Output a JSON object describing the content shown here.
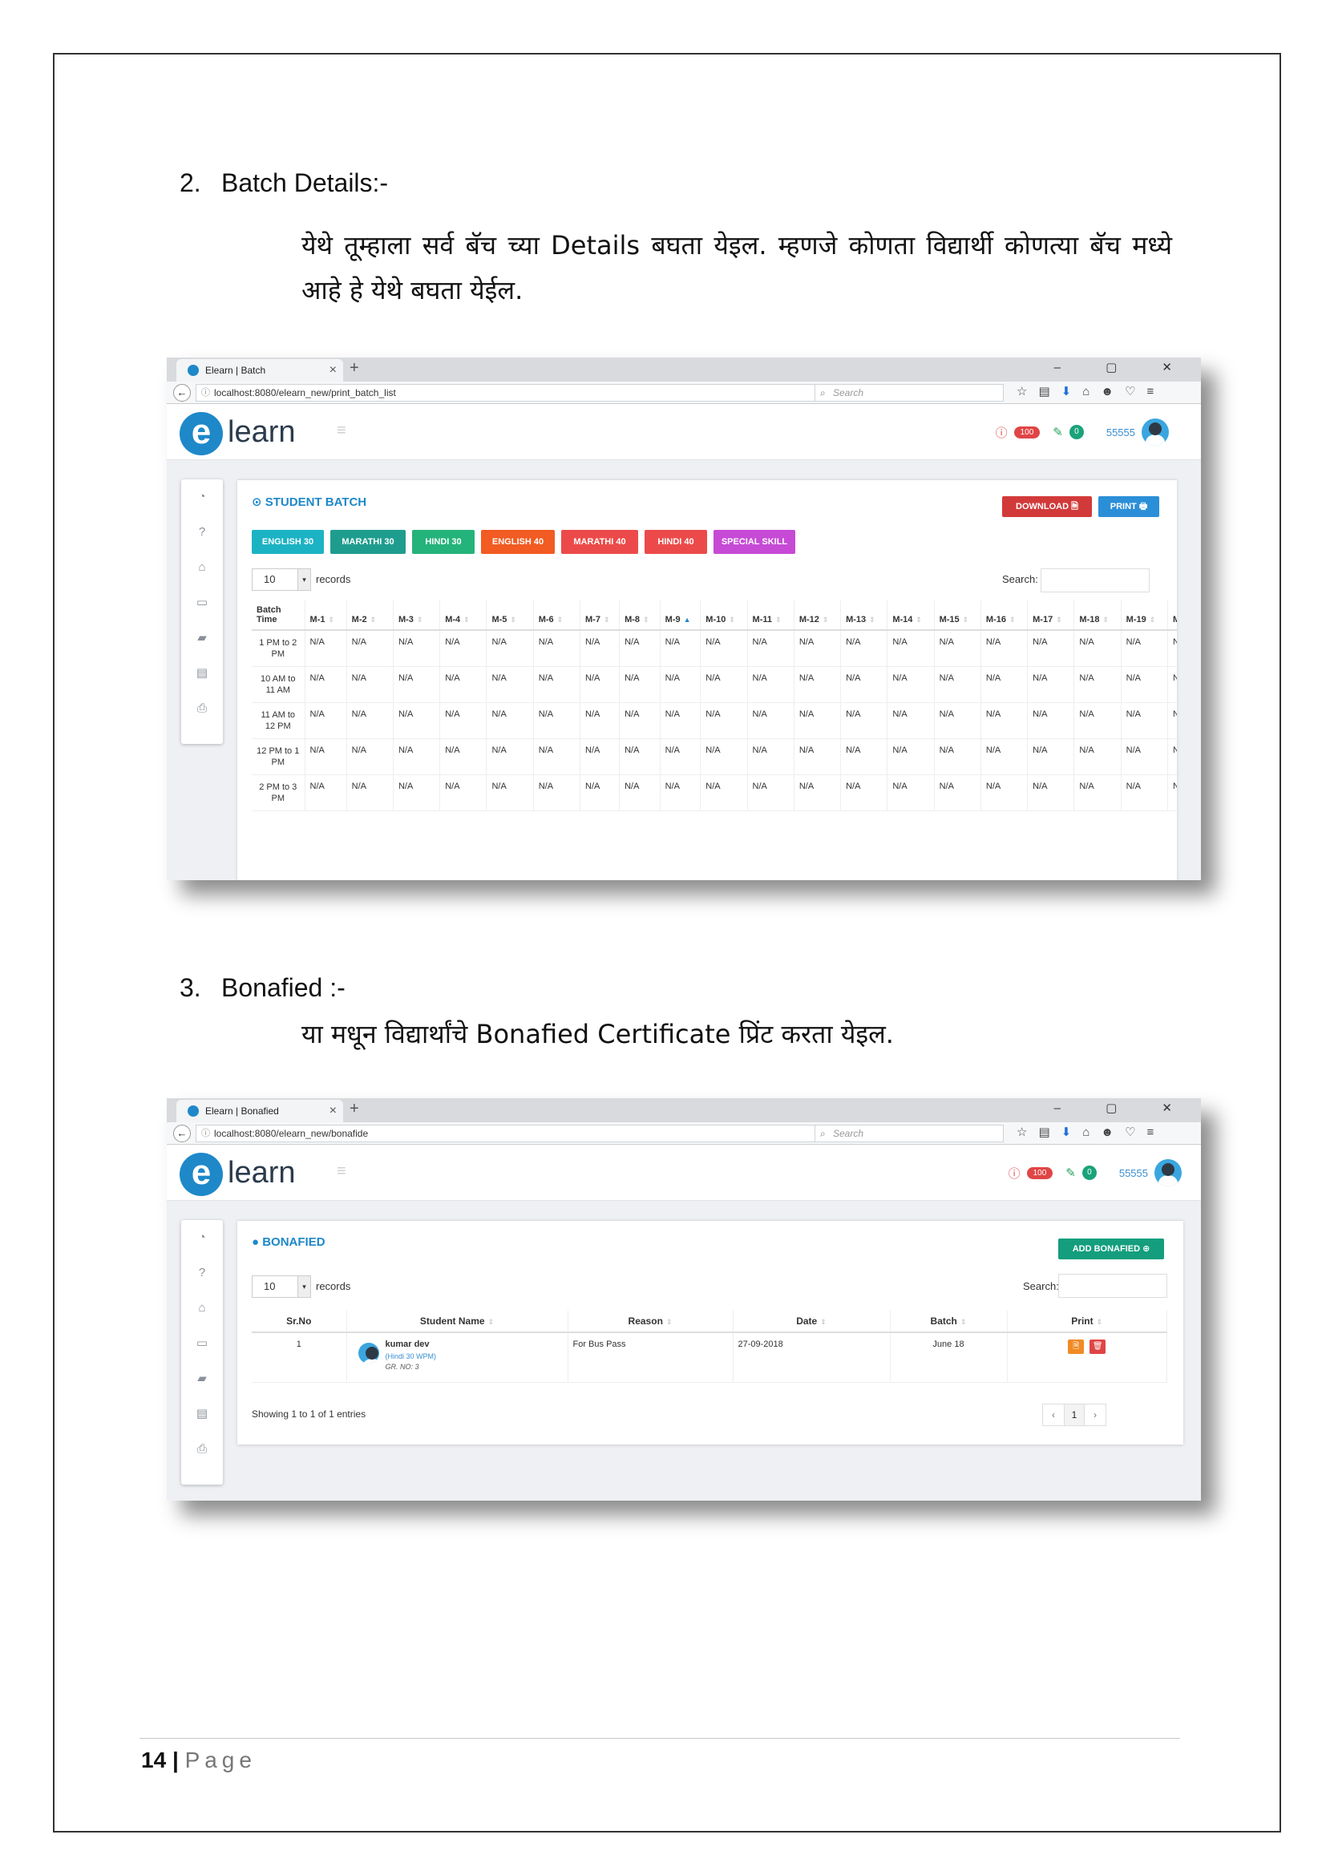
{
  "section2": {
    "num": "2.",
    "heading": "Batch Details:-",
    "para": "येथे तूम्हाला सर्व बॅच च्या Details बघता येइल. म्हणजे कोणता विद्यार्थी कोणत्या बॅच मध्ये आहे हे येथे बघता येईल."
  },
  "section3": {
    "num": "3.",
    "heading": "Bonafied :-",
    "para": "या मधून विद्यार्थांचे Bonafied Certificate प्रिंट करता येइल."
  },
  "browser": {
    "new_tab": "+",
    "window_buttons": "– ▢ ✕",
    "search_placeholder": "Search",
    "search_glass": "⌕",
    "reload": "↻",
    "info": "ⓘ",
    "back": "←"
  },
  "app": {
    "logo_letter": "e",
    "logo_text": "learn",
    "notifications": "100",
    "edits": "0",
    "user_id": "55555"
  },
  "batch_shot": {
    "tab_title": "Elearn | Batch",
    "url": "localhost:8080/elearn_new/print_batch_list",
    "card_title": "⊙ STUDENT BATCH",
    "download_label": "DOWNLOAD 🗎",
    "print_label": "PRINT 🖶",
    "tags": [
      "ENGLISH 30",
      "MARATHI 30",
      "HINDI 30",
      "ENGLISH 40",
      "MARATHI 40",
      "HINDI 40",
      "SPECIAL SKILL"
    ],
    "records_value": "10",
    "records_label": "records",
    "search_label": "Search:",
    "columns": [
      "Batch Time",
      "M-1",
      "M-2",
      "M-3",
      "M-4",
      "M-5",
      "M-6",
      "M-7",
      "M-8",
      "M-9",
      "M-10",
      "M-11",
      "M-12",
      "M-13",
      "M-14",
      "M-15",
      "M-16",
      "M-17",
      "M-18",
      "M-19",
      "M"
    ],
    "rows": [
      {
        "time": "1 PM to 2 PM",
        "cells": [
          "N/A",
          "N/A",
          "N/A",
          "N/A",
          "N/A",
          "N/A",
          "N/A",
          "N/A",
          "N/A",
          "N/A",
          "N/A",
          "N/A",
          "N/A",
          "N/A",
          "N/A",
          "N/A",
          "N/A",
          "N/A",
          "N/A",
          "N/"
        ]
      },
      {
        "time": "10 AM to 11 AM",
        "cells": [
          "N/A",
          "N/A",
          "N/A",
          "N/A",
          "N/A",
          "N/A",
          "N/A",
          "N/A",
          "N/A",
          "N/A",
          "N/A",
          "N/A",
          "N/A",
          "N/A",
          "N/A",
          "N/A",
          "N/A",
          "N/A",
          "N/A",
          "N/"
        ]
      },
      {
        "time": "11 AM to 12 PM",
        "cells": [
          "N/A",
          "N/A",
          "N/A",
          "N/A",
          "N/A",
          "N/A",
          "N/A",
          "N/A",
          "N/A",
          "N/A",
          "N/A",
          "N/A",
          "N/A",
          "N/A",
          "N/A",
          "N/A",
          "N/A",
          "N/A",
          "N/A",
          "N/"
        ]
      },
      {
        "time": "12 PM to 1 PM",
        "cells": [
          "N/A",
          "N/A",
          "N/A",
          "N/A",
          "N/A",
          "N/A",
          "N/A",
          "N/A",
          "N/A",
          "N/A",
          "N/A",
          "N/A",
          "N/A",
          "N/A",
          "N/A",
          "N/A",
          "N/A",
          "N/A",
          "N/A",
          "N/"
        ]
      },
      {
        "time": "2 PM to 3 PM",
        "cells": [
          "N/A",
          "N/A",
          "N/A",
          "N/A",
          "N/A",
          "N/A",
          "N/A",
          "N/A",
          "N/A",
          "N/A",
          "N/A",
          "N/A",
          "N/A",
          "N/A",
          "N/A",
          "N/A",
          "N/A",
          "N/A",
          "N/A",
          "N/"
        ]
      }
    ]
  },
  "bonafied_shot": {
    "tab_title": "Elearn | Bonafied",
    "url": "localhost:8080/elearn_new/bonafide",
    "card_title": "● BONAFIED",
    "add_label": "ADD BONAFIED ⊕",
    "records_value": "10",
    "records_label": "records",
    "search_label": "Search:",
    "columns": [
      "Sr.No",
      "Student Name",
      "Reason",
      "Date",
      "Batch",
      "Print"
    ],
    "row": {
      "sr": "1",
      "name": "kumar dev",
      "sub": "(Hindi 30 WPM)",
      "gr": "GR. NO: 3",
      "reason": "For Bus Pass",
      "date": "27-09-2018",
      "batch": "June 18"
    },
    "showing": "Showing 1 to 1 of 1 entries",
    "pager": [
      "‹",
      "1",
      "›"
    ]
  },
  "footer": {
    "page_num": "14",
    "sep": "|",
    "page_word": "Page"
  },
  "colors": {
    "brand_blue": "#1e88c9",
    "download_red": "#d23a3a",
    "print_blue": "#2b8fd8",
    "add_green": "#149e7e"
  },
  "icons": [
    "dashboard-icon",
    "help-icon",
    "bank-icon",
    "card-icon",
    "book-icon",
    "id-card-icon",
    "print-icon"
  ]
}
